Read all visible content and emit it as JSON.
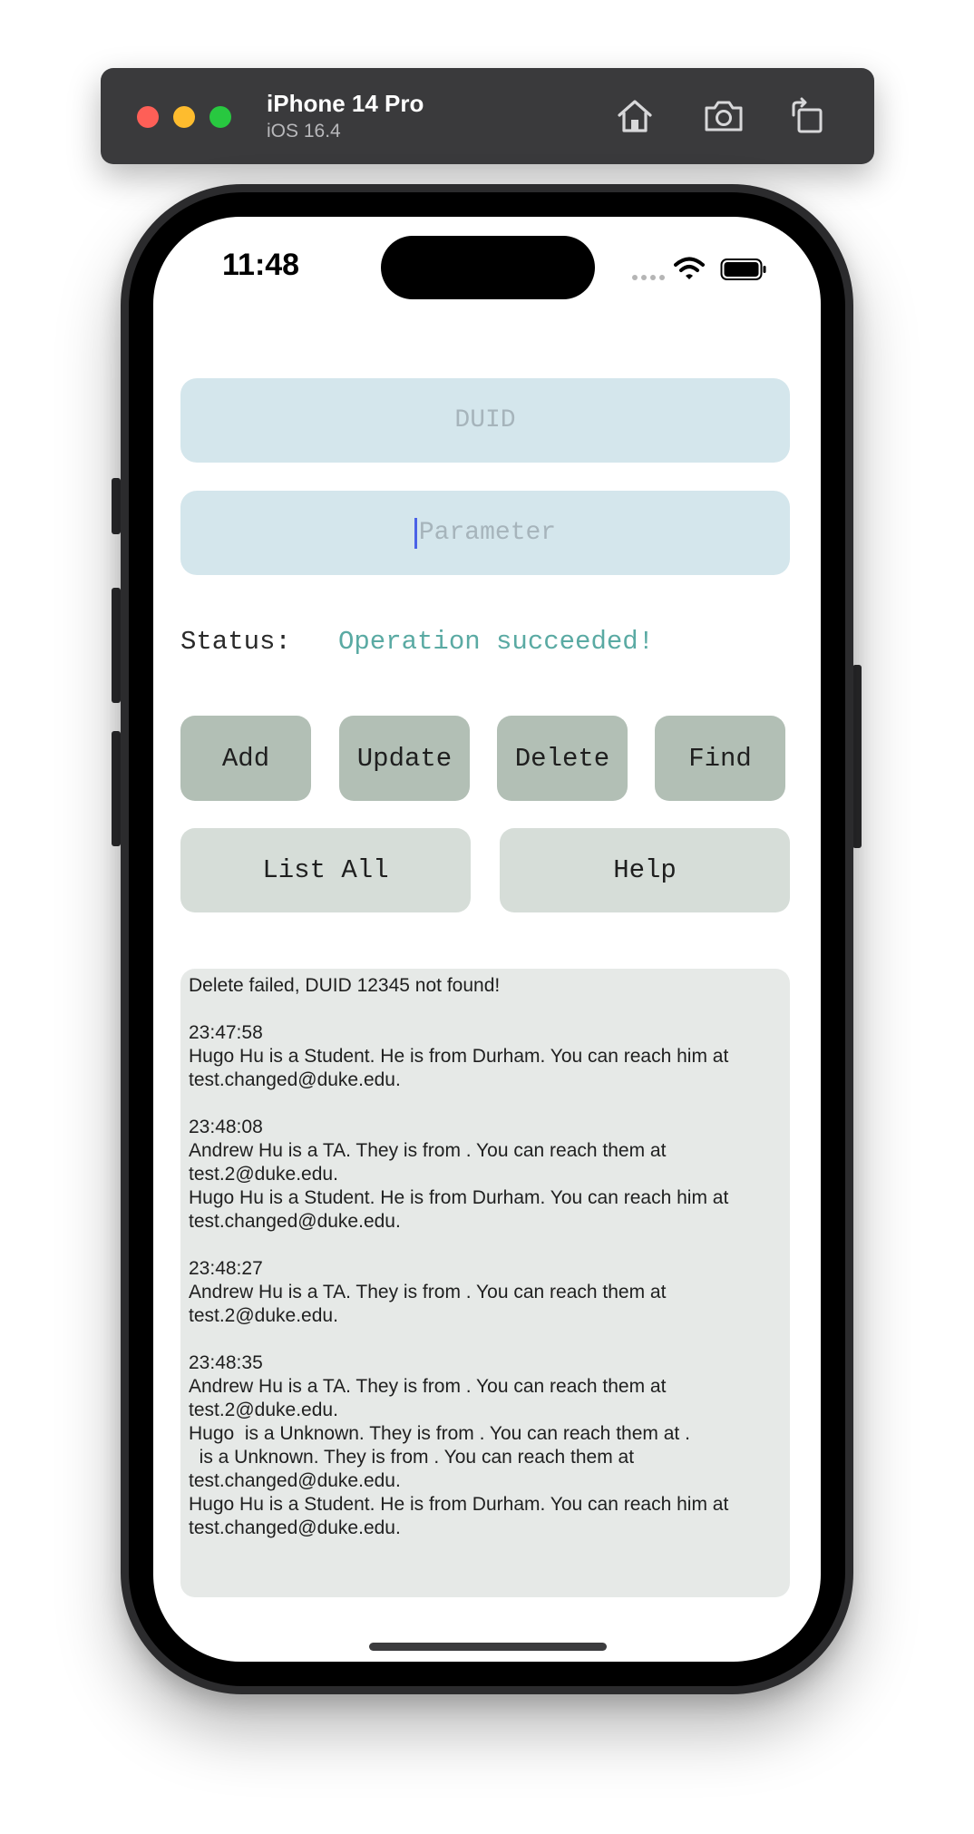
{
  "simulator": {
    "device_name": "iPhone 14 Pro",
    "os_version": "iOS 16.4",
    "icons": [
      "home-icon",
      "screenshot-icon",
      "rotate-icon"
    ]
  },
  "status_bar": {
    "time": "11:48"
  },
  "form": {
    "duid_placeholder": "DUID",
    "parameter_placeholder": "Parameter"
  },
  "status": {
    "label": "Status:",
    "value": "Operation succeeded!",
    "value_color": "#5aaaa3"
  },
  "buttons": {
    "add": "Add",
    "update": "Update",
    "delete": "Delete",
    "find": "Find",
    "list_all": "List All",
    "help": "Help"
  },
  "log": {
    "text": "Delete failed, DUID 12345 not found!\n\n23:47:58\nHugo Hu is a Student. He is from Durham. You can reach him at test.changed@duke.edu.\n\n23:48:08\nAndrew Hu is a TA. They is from . You can reach them at test.2@duke.edu.\nHugo Hu is a Student. He is from Durham. You can reach him at test.changed@duke.edu.\n\n23:48:27\nAndrew Hu is a TA. They is from . You can reach them at test.2@duke.edu.\n\n23:48:35\nAndrew Hu is a TA. They is from . You can reach them at test.2@duke.edu.\nHugo  is a Unknown. They is from . You can reach them at .\n  is a Unknown. They is from . You can reach them at test.changed@duke.edu.\nHugo Hu is a Student. He is from Durham. You can reach him at test.changed@duke.edu."
  },
  "colors": {
    "field_bg": "#d4e6ec",
    "button_dark": "#b2bfb5",
    "button_light": "#d6ddd8",
    "log_bg": "#e6e9e7"
  }
}
